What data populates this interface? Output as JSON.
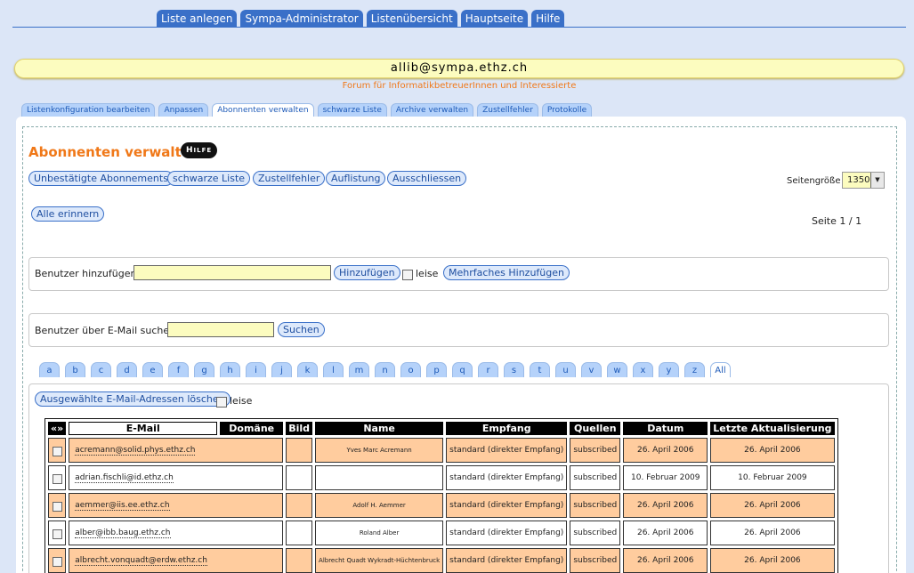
{
  "topnav": [
    "Liste anlegen",
    "Sympa-Administrator",
    "Listenübersicht",
    "Hauptseite",
    "Hilfe"
  ],
  "list_address": "allib@sympa.ethz.ch",
  "list_subject": "Forum für InformatikbetreuerInnen und Interessierte",
  "subtabs": [
    "Listenkonfiguration bearbeiten",
    "Anpassen",
    "Abonnenten verwalten",
    "schwarze Liste",
    "Archive verwalten",
    "Zustellfehler",
    "Protokolle"
  ],
  "active_subtab": "Abonnenten verwalten",
  "page_title": "Abonnenten verwalten",
  "help_badge": "Hilfe",
  "actions": {
    "unconfirmed": "Unbestätigte Abonnements",
    "blacklist": "schwarze Liste",
    "bounces": "Zustellfehler",
    "listing": "Auflistung",
    "exclude": "Ausschliessen",
    "remind_all": "Alle erinnern"
  },
  "page_size": {
    "label": "Seitengröße",
    "value": "1350"
  },
  "pagination": "Seite 1 / 1",
  "add_user": {
    "label": "Benutzer hinzufügen:",
    "button": "Hinzufügen",
    "quiet_label": "leise",
    "multi_button": "Mehrfaches Hinzufügen"
  },
  "search": {
    "label": "Benutzer über E-Mail suchen:",
    "button": "Suchen"
  },
  "alphabet": [
    "a",
    "b",
    "c",
    "d",
    "e",
    "f",
    "g",
    "h",
    "i",
    "j",
    "k",
    "l",
    "m",
    "n",
    "o",
    "p",
    "q",
    "r",
    "s",
    "t",
    "u",
    "v",
    "w",
    "x",
    "y",
    "z",
    "All"
  ],
  "delete_selected": {
    "button": "Ausgewählte E-Mail-Adressen löschen",
    "quiet_label": "leise"
  },
  "table": {
    "headers": {
      "toggle": "«»",
      "email": "E-Mail",
      "domain": "Domäne",
      "picture": "Bild",
      "name": "Name",
      "reception": "Empfang",
      "sources": "Quellen",
      "date": "Datum",
      "last_update": "Letzte Aktualisierung"
    },
    "rows": [
      {
        "email": "acremann@solid.phys.ethz.ch",
        "name": "Yves Marc Acremann",
        "reception": "standard (direkter Empfang)",
        "sources": "subscribed",
        "date": "26. April 2006",
        "update": "26. April 2006"
      },
      {
        "email": "adrian.fischli@id.ethz.ch",
        "name": "",
        "reception": "standard (direkter Empfang)",
        "sources": "subscribed",
        "date": "10. Februar 2009",
        "update": "10. Februar 2009"
      },
      {
        "email": "aemmer@iis.ee.ethz.ch",
        "name": "Adolf H. Aemmer",
        "reception": "standard (direkter Empfang)",
        "sources": "subscribed",
        "date": "26. April 2006",
        "update": "26. April 2006"
      },
      {
        "email": "alber@ibb.baug.ethz.ch",
        "name": "Roland Alber",
        "reception": "standard (direkter Empfang)",
        "sources": "subscribed",
        "date": "26. April 2006",
        "update": "26. April 2006"
      },
      {
        "email": "albrecht.vonquadt@erdw.ethz.ch",
        "name": "Albrecht Quadt Wykradt-Hüchtenbruck",
        "reception": "standard (direkter Empfang)",
        "sources": "subscribed",
        "date": "26. April 2006",
        "update": "26. April 2006"
      }
    ]
  },
  "colors": {
    "tab_blue": "#3a70c8",
    "accent_orange": "#f07818",
    "highlight_yellow": "#fcfcbf",
    "row_orange": "#ffcc9e"
  }
}
